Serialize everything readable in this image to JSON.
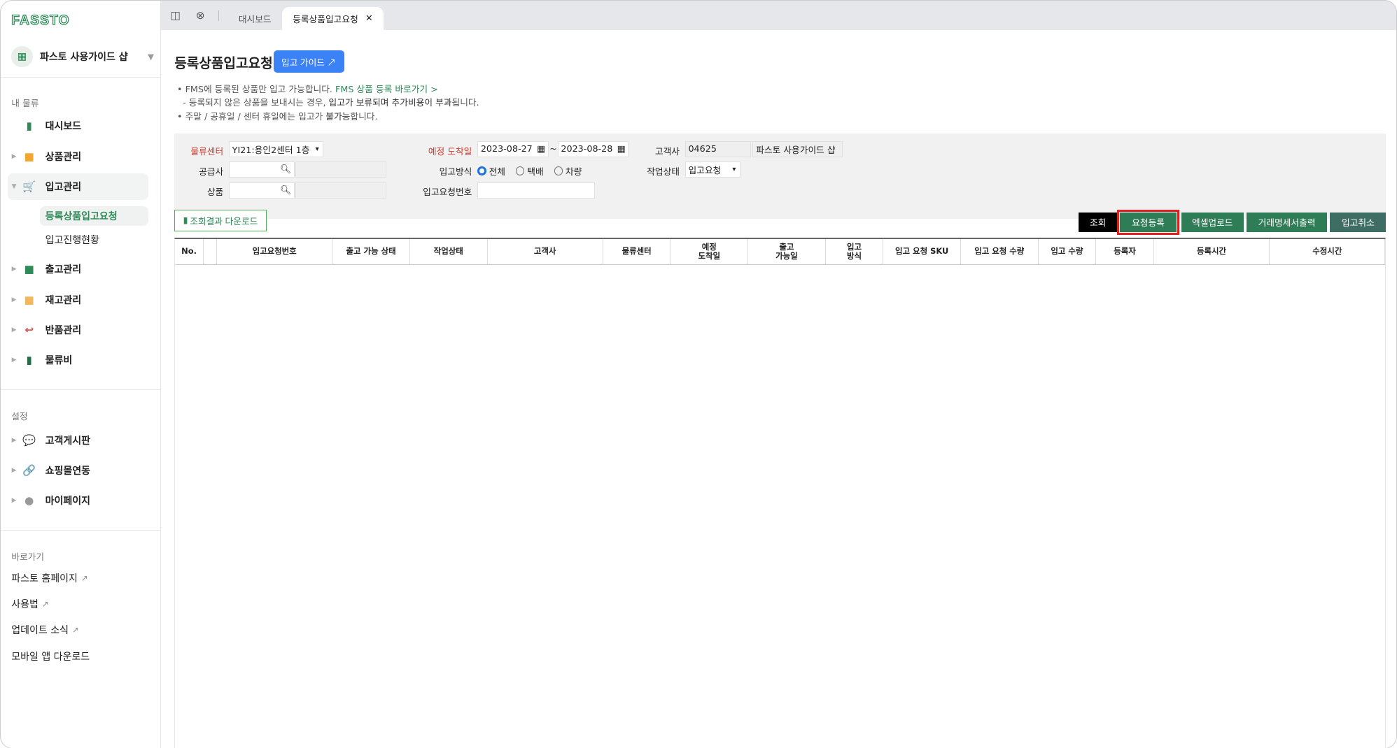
{
  "logo": "FASSTO",
  "shop_name": "파스토 사용가이드 샵",
  "sidebar": {
    "section_my": "내 물류",
    "items": [
      {
        "label": "대시보드"
      },
      {
        "label": "상품관리"
      },
      {
        "label": "입고관리"
      },
      {
        "label": "출고관리"
      },
      {
        "label": "재고관리"
      },
      {
        "label": "반품관리"
      },
      {
        "label": "물류비"
      }
    ],
    "subitems": [
      {
        "label": "등록상품입고요청"
      },
      {
        "label": "입고진행현황"
      }
    ],
    "section_settings": "설정",
    "settings": [
      {
        "label": "고객게시판"
      },
      {
        "label": "쇼핑몰연동"
      },
      {
        "label": "마이페이지"
      }
    ],
    "section_shortcuts": "바로가기",
    "shortcuts": [
      {
        "label": "파스토 홈페이지"
      },
      {
        "label": "사용법"
      },
      {
        "label": "업데이트 소식"
      },
      {
        "label": "모바일 앱 다운로드"
      }
    ]
  },
  "tabs": [
    {
      "label": "대시보드"
    },
    {
      "label": "등록상품입고요청"
    }
  ],
  "page": {
    "title": "등록상품입고요청",
    "guide_button": "입고 가이드 ↗",
    "note1": "• FMS에 등록된 상품만 입고 가능합니다.",
    "note1_link": "FMS 상품 등록 바로가기 >",
    "note2a": "- 등록되지 않은 상품을 보내시는 경우, ",
    "note2b": "입고가 보류되며 추가비용이 부과",
    "note2c": "됩니다.",
    "note3a": "• 주말 / 공휴일 / 센터 휴일에는 입고가 ",
    "note3b": "불가능",
    "note3c": "합니다."
  },
  "filter": {
    "center_label": "물류센터",
    "center_value": "YI21:용인2센터 1층",
    "supplier_label": "공급사",
    "product_label": "상품",
    "arrival_label": "예정 도착일",
    "date_from": "2023-08-27",
    "date_sep": "~",
    "date_to": "2023-08-28",
    "method_label": "입고방식",
    "methods": [
      "전체",
      "택배",
      "차량"
    ],
    "request_no_label": "입고요청번호",
    "customer_label": "고객사",
    "customer_code": "04625",
    "customer_name": "파스토 사용가이드 샵",
    "status_label": "작업상태",
    "status_value": "입고요청"
  },
  "actions": {
    "download": "조회결과 다운로드",
    "search": "조회",
    "register": "요청등록",
    "excel": "엑셀업로드",
    "statement": "거래명세서출력",
    "cancel": "입고취소"
  },
  "colors": {
    "green": "#2e7d57",
    "red": "#d23b2f",
    "blue": "#3b82f6",
    "highlight": "#e02020"
  },
  "table": {
    "headers": [
      "No.",
      "",
      "입고요청번호",
      "출고 가능 상태",
      "작업상태",
      "고객사",
      "물류센터",
      "예정\n도착일",
      "출고\n가능일",
      "입고\n방식",
      "입고 요청 SKU",
      "입고 요청 수량",
      "입고 수량",
      "등록자",
      "등록시간",
      "수정시간"
    ]
  }
}
